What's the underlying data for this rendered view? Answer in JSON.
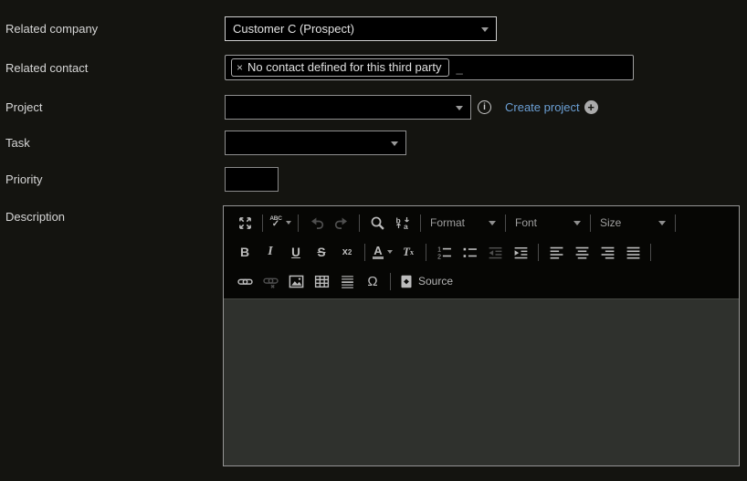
{
  "colors": {
    "page_bg": "#141410",
    "field_bg": "#000000",
    "field_border": "#8f8f8f",
    "link_blue": "#6b9fd4",
    "editor_toolbar_bg": "#060604",
    "editor_content_bg": "#2f312d"
  },
  "form": {
    "related_company": {
      "label": "Related company",
      "value": "Customer C (Prospect)"
    },
    "related_contact": {
      "label": "Related contact",
      "tag_remove_glyph": "×",
      "tag_text": "No contact defined for this third party",
      "cursor": "_"
    },
    "project": {
      "label": "Project",
      "value": "",
      "info_glyph": "i",
      "create_link_label": "Create project",
      "plus_glyph": "+"
    },
    "task": {
      "label": "Task",
      "value": ""
    },
    "priority": {
      "label": "Priority",
      "value": ""
    },
    "description": {
      "label": "Description"
    }
  },
  "editor": {
    "toolbar": {
      "spell_label": "ABC",
      "spell_check_glyph": "✓",
      "format_label": "Format",
      "font_label": "Font",
      "size_label": "Size",
      "bold_glyph": "B",
      "italic_glyph": "I",
      "underline_glyph": "U",
      "strike_glyph": "S",
      "superscript_base": "x",
      "superscript_exp": "2",
      "textcolor_glyph": "A",
      "removeformat_base": "T",
      "removeformat_sub": "x",
      "replace_letter_top": "b",
      "replace_letter_bottom": "a",
      "ol_num1": "1",
      "ol_num2": "2",
      "omega_glyph": "Ω",
      "source_label": "Source"
    },
    "content_text": ""
  }
}
